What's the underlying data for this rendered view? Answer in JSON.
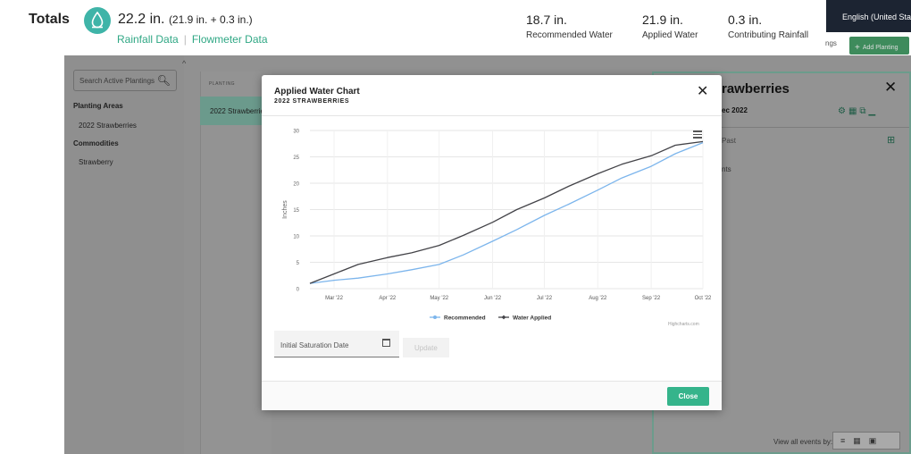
{
  "totals": {
    "label": "Totals",
    "total_value": "22.2 in.",
    "total_breakdown": "(21.9 in. + 0.3 in.)",
    "rainfall_link": "Rainfall Data",
    "separator": "|",
    "flowmeter_link": "Flowmeter Data",
    "stats": [
      {
        "value": "18.7 in.",
        "label": "Recommended Water"
      },
      {
        "value": "21.9 in.",
        "label": "Applied Water"
      },
      {
        "value": "0.3 in.",
        "label": "Contributing Rainfall"
      }
    ]
  },
  "language": "English (United States)",
  "background": {
    "search_placeholder": "Search Active Plantings",
    "planting_areas_heading": "Planting Areas",
    "planting_area_item": "2022 Strawberries",
    "commodities_heading": "Commodities",
    "commodity_item": "Strawberry",
    "table_header": "PLANTING",
    "table_row": "2022 Strawberries",
    "panel_title": "rawberries",
    "panel_sub": "ec 2022",
    "panel_past": "Past",
    "panel_events": "nts",
    "view_all_label": "View all events by:",
    "settings_fragment": "ngs",
    "add_planting": "Add Planting"
  },
  "modal": {
    "title": "Applied Water Chart",
    "subtitle": "2022 STRAWBERRIES",
    "credit": "Highcharts.com",
    "saturation_placeholder": "Initial Saturation Date",
    "update_label": "Update",
    "close_label": "Close"
  },
  "colors": {
    "accent": "#35b48b",
    "recommended": "#7cb5ec",
    "applied": "#434348"
  },
  "chart_data": {
    "type": "line",
    "title": "",
    "xlabel": "",
    "ylabel": "Inches",
    "ylim": [
      0,
      30
    ],
    "yticks": [
      0,
      5,
      10,
      15,
      20,
      25,
      30
    ],
    "xlim": [
      "2022-02-15",
      "2022-10-01"
    ],
    "xticks": [
      {
        "date": "2022-03-01",
        "label": "Mar '22"
      },
      {
        "date": "2022-04-01",
        "label": "Apr '22"
      },
      {
        "date": "2022-05-01",
        "label": "May '22"
      },
      {
        "date": "2022-06-01",
        "label": "Jun '22"
      },
      {
        "date": "2022-07-01",
        "label": "Jul '22"
      },
      {
        "date": "2022-08-01",
        "label": "Aug '22"
      },
      {
        "date": "2022-09-01",
        "label": "Sep '22"
      },
      {
        "date": "2022-10-01",
        "label": "Oct '22"
      }
    ],
    "grid": true,
    "legend": "bottom-center",
    "series": [
      {
        "name": "Recommended",
        "points": [
          [
            "2022-02-15",
            1.0
          ],
          [
            "2022-03-01",
            1.6
          ],
          [
            "2022-03-15",
            2.0
          ],
          [
            "2022-04-01",
            2.8
          ],
          [
            "2022-04-15",
            3.6
          ],
          [
            "2022-05-01",
            4.6
          ],
          [
            "2022-05-15",
            6.4
          ],
          [
            "2022-06-01",
            9.0
          ],
          [
            "2022-06-15",
            11.2
          ],
          [
            "2022-07-01",
            13.9
          ],
          [
            "2022-07-15",
            16.0
          ],
          [
            "2022-08-01",
            18.7
          ],
          [
            "2022-08-15",
            21.0
          ],
          [
            "2022-09-01",
            23.2
          ],
          [
            "2022-09-15",
            25.6
          ],
          [
            "2022-10-01",
            27.7
          ]
        ]
      },
      {
        "name": "Water Applied",
        "points": [
          [
            "2022-02-15",
            1.0
          ],
          [
            "2022-03-01",
            2.8
          ],
          [
            "2022-03-15",
            4.6
          ],
          [
            "2022-04-01",
            5.9
          ],
          [
            "2022-04-15",
            6.8
          ],
          [
            "2022-05-01",
            8.2
          ],
          [
            "2022-05-15",
            10.1
          ],
          [
            "2022-06-01",
            12.6
          ],
          [
            "2022-06-15",
            15.0
          ],
          [
            "2022-07-01",
            17.2
          ],
          [
            "2022-07-15",
            19.4
          ],
          [
            "2022-08-01",
            21.8
          ],
          [
            "2022-08-15",
            23.6
          ],
          [
            "2022-09-01",
            25.2
          ],
          [
            "2022-09-15",
            27.2
          ],
          [
            "2022-10-01",
            27.9
          ]
        ]
      }
    ]
  }
}
